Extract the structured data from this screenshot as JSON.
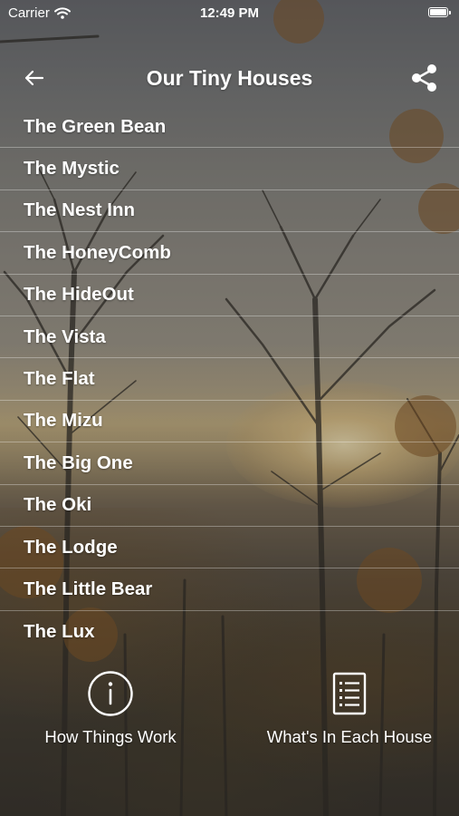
{
  "status_bar": {
    "carrier": "Carrier",
    "time": "12:49 PM"
  },
  "nav": {
    "title": "Our Tiny Houses",
    "back_icon": "arrow-left-icon",
    "share_icon": "share-icon"
  },
  "houses": [
    "The Green Bean",
    "The Mystic",
    "The Nest Inn",
    "The HoneyComb",
    "The HideOut",
    "The Vista",
    "The Flat",
    "The Mizu",
    "The Big One",
    "The Oki",
    "The Lodge",
    "The Little Bear",
    "The Lux"
  ],
  "bottom_actions": {
    "how_things_work": {
      "label": "How Things Work",
      "icon": "info-circle-icon"
    },
    "whats_in_each_house": {
      "label": "What's In Each House",
      "icon": "document-list-icon"
    }
  },
  "colors": {
    "text": "#ffffff",
    "divider": "rgba(255,255,255,0.32)"
  }
}
